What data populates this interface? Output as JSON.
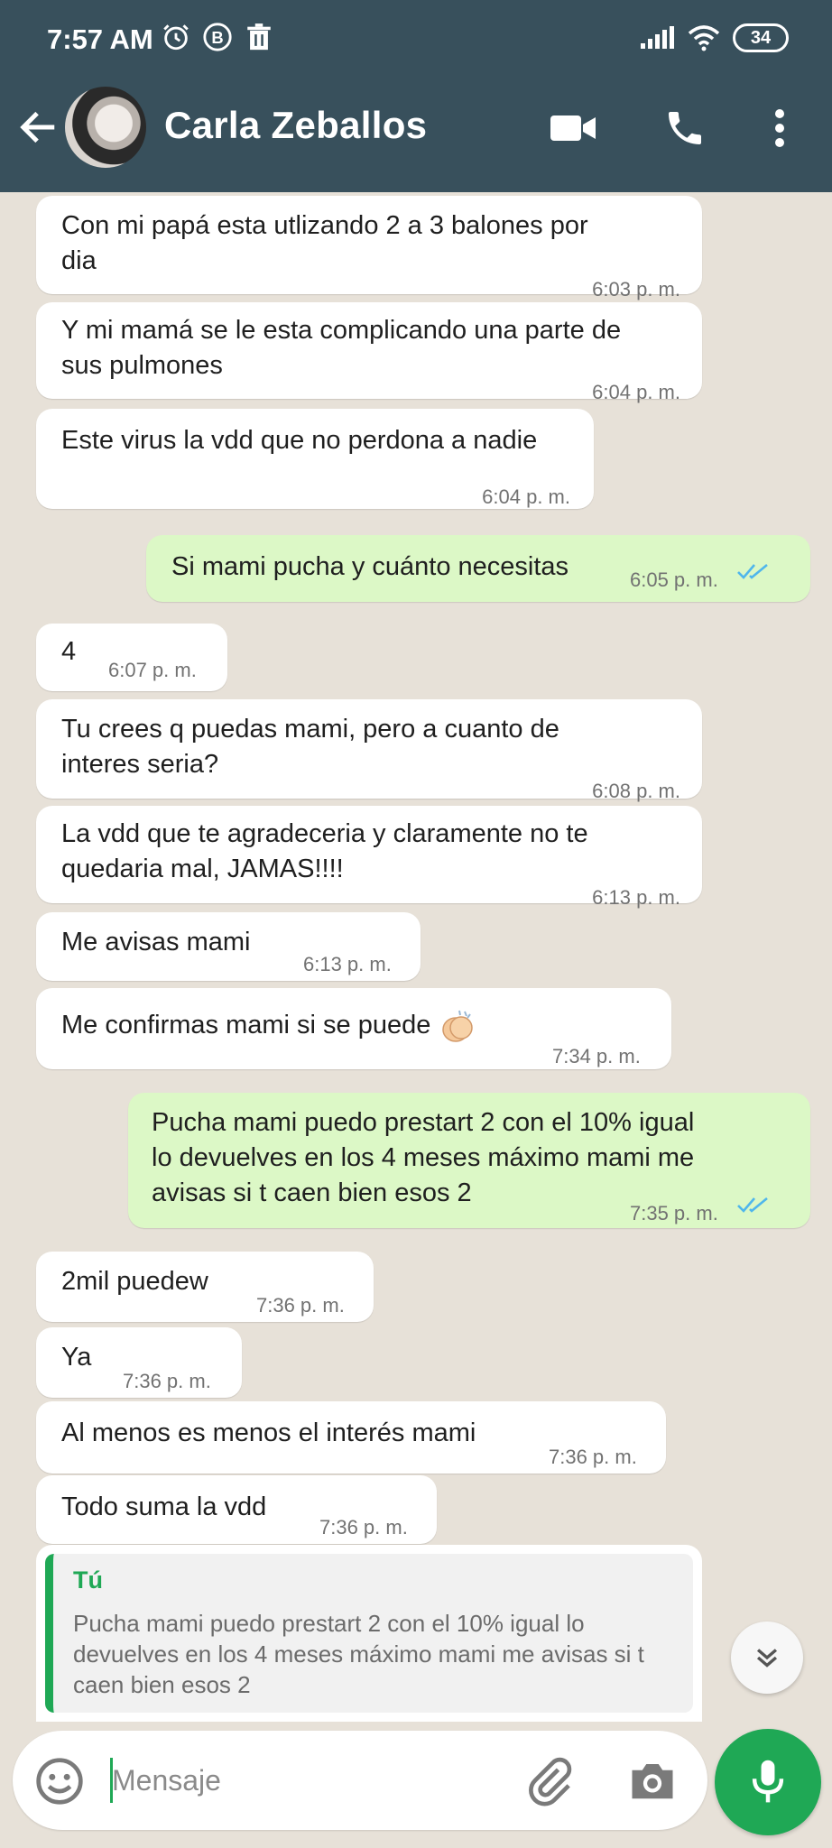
{
  "status_bar": {
    "time": "7:57 AM",
    "battery": "34"
  },
  "header": {
    "contact_name": "Carla Zeballos"
  },
  "messages": [
    {
      "dir": "in",
      "text": "Con mi papá esta utlizando 2 a 3 balones por\ndia",
      "time": "6:03 p. m."
    },
    {
      "dir": "in",
      "text": "Y mi mamá se le esta complicando una parte de\nsus pulmones",
      "time": "6:04 p. m."
    },
    {
      "dir": "in",
      "text": "Este virus la vdd que no perdona a nadie",
      "time": "6:04 p. m."
    },
    {
      "dir": "out",
      "text": "Si mami pucha y cuánto necesitas",
      "time": "6:05 p. m.",
      "status": "read"
    },
    {
      "dir": "in",
      "text": "4",
      "time": "6:07 p. m."
    },
    {
      "dir": "in",
      "text": "Tu crees q puedas mami, pero a cuanto de\ninteres seria?",
      "time": "6:08 p. m."
    },
    {
      "dir": "in",
      "text": "La vdd que te agradeceria y claramente no te\nquedaria mal, JAMAS!!!!",
      "time": "6:13 p. m."
    },
    {
      "dir": "in",
      "text": "Me avisas mami",
      "time": "6:13 p. m."
    },
    {
      "dir": "in",
      "text": "Me confirmas mami si se puede",
      "time": "7:34 p. m.",
      "emoji": "clapping-hands-emoji"
    },
    {
      "dir": "out",
      "text": "Pucha mami puedo prestart 2 con el 10% igual\nlo devuelves en los 4 meses máximo mami me\navisas si t caen bien esos 2",
      "time": "7:35 p. m.",
      "status": "read"
    },
    {
      "dir": "in",
      "text": "2mil puedew",
      "time": "7:36 p. m."
    },
    {
      "dir": "in",
      "text": "Ya",
      "time": "7:36 p. m."
    },
    {
      "dir": "in",
      "text": "Al menos es menos el interés mami",
      "time": "7:36 p. m."
    },
    {
      "dir": "in",
      "text": "Todo suma la vdd",
      "time": "7:36 p. m."
    }
  ],
  "reply_preview": {
    "author": "Tú",
    "text": "Pucha mami puedo prestart 2 con el 10% igual lo devuelves en los 4 meses máximo mami me avisas si t caen bien esos 2"
  },
  "composer": {
    "placeholder": "Mensaje",
    "value": ""
  },
  "colors": {
    "app_bar": "#38505c",
    "chat_background": "#e7e1d8",
    "incoming_bubble": "#ffffff",
    "outgoing_bubble": "#dcf8c6",
    "accent": "#1fa855",
    "read_ticks": "#4fb6ec"
  }
}
